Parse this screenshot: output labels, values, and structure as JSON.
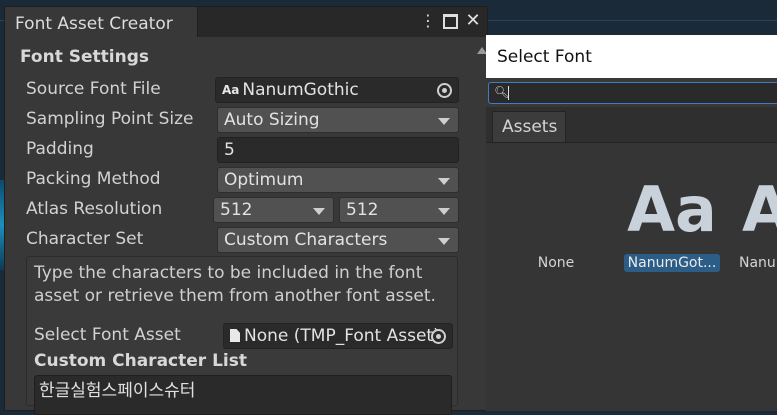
{
  "font_asset_creator": {
    "tab_title": "Font Asset Creator",
    "section_title": "Font Settings",
    "fields": {
      "source_font_file": {
        "label": "Source Font File",
        "value": "NanumGothic",
        "icon": "font-asset-icon",
        "prefix": "Aa"
      },
      "sampling_point_size": {
        "label": "Sampling Point Size",
        "value": "Auto Sizing"
      },
      "padding": {
        "label": "Padding",
        "value": "5"
      },
      "packing_method": {
        "label": "Packing Method",
        "value": "Optimum"
      },
      "atlas_resolution": {
        "label": "Atlas Resolution",
        "width": "512",
        "height": "512"
      },
      "character_set": {
        "label": "Character Set",
        "value": "Custom Characters"
      }
    },
    "help_text": "Type the characters to be included in the font asset or retrieve them from another font asset.",
    "select_font_asset": {
      "label": "Select Font Asset",
      "value": "None (TMP_Font Asset)"
    },
    "custom_character_list": {
      "title": "Custom Character List",
      "value": "한글실험스페이스슈터"
    }
  },
  "select_font": {
    "title": "Select Font",
    "search": {
      "value": "",
      "icon": "search-icon"
    },
    "tabs": [
      "Assets"
    ],
    "items": [
      {
        "name": "None",
        "preview": "",
        "selected": false
      },
      {
        "name": "NanumGot...",
        "preview": "Aa",
        "selected": true
      },
      {
        "name": "Nanu",
        "preview": "A",
        "selected": false
      }
    ]
  },
  "colors": {
    "panel_bg": "#383838",
    "selection": "#2c5d87",
    "search_focus": "#3f7cc4",
    "background": "#1b2a38"
  }
}
